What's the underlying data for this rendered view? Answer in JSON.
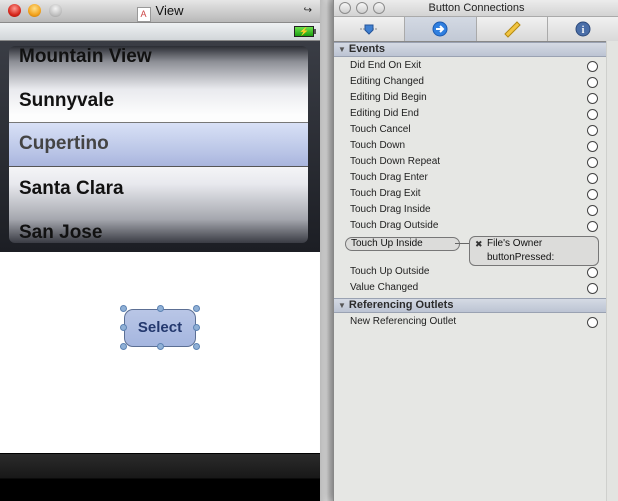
{
  "view_window": {
    "title": "View",
    "picker": {
      "rows": [
        "Mountain View",
        "Sunnyvale",
        "Cupertino",
        "Santa Clara",
        "San Jose"
      ],
      "selected": "Cupertino"
    },
    "button": {
      "label": "Select"
    },
    "battery_glyph": "⚡"
  },
  "inspector": {
    "title": "Button Connections",
    "tabs": [
      {
        "name": "attributes-tab",
        "icon": "slider-icon"
      },
      {
        "name": "connections-tab",
        "icon": "arrow-circle-icon",
        "active": true
      },
      {
        "name": "size-tab",
        "icon": "ruler-icon"
      },
      {
        "name": "identity-tab",
        "icon": "info-icon"
      }
    ],
    "events_header": "Events",
    "events": [
      "Did End On Exit",
      "Editing Changed",
      "Editing Did Begin",
      "Editing Did End",
      "Touch Cancel",
      "Touch Down",
      "Touch Down Repeat",
      "Touch Drag Enter",
      "Touch Drag Exit",
      "Touch Drag Inside",
      "Touch Drag Outside",
      "Touch Up Inside",
      "Touch Up Outside",
      "Value Changed"
    ],
    "connection": {
      "event": "Touch Up Inside",
      "target": "File's Owner",
      "action": "buttonPressed:",
      "remove_glyph": "✖"
    },
    "outlets_header": "Referencing Outlets",
    "outlets": [
      "New Referencing Outlet"
    ]
  }
}
